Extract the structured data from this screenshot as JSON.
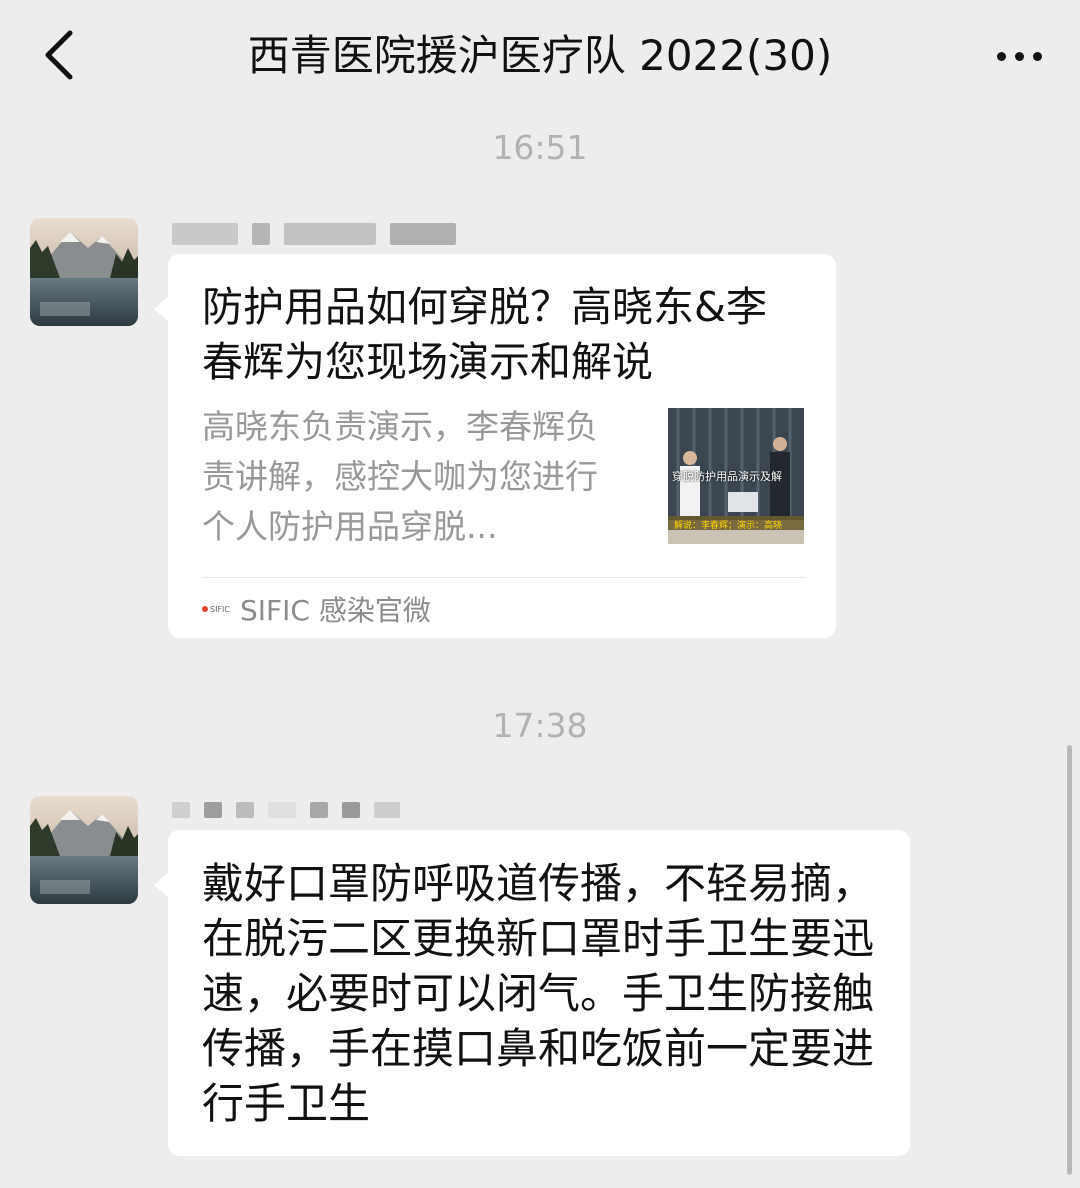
{
  "header": {
    "title": "西青医院援沪医疗队 2022(30)",
    "back_icon": "chevron-left-icon",
    "more_icon": "more-horizontal-icon"
  },
  "messages": [
    {
      "time": "16:51",
      "type": "link-card",
      "card": {
        "title": "防护用品如何穿脱？高晓东&李春辉为您现场演示和解说",
        "description": "高晓东负责演示，李春辉负责讲解，感控大咖为您进行个人防护用品穿脱...",
        "thumb_text": "穿脱防护用品演示及解",
        "thumb_caption": "解说：李春辉；演示：高晓",
        "source_logo_text": "SIFIC",
        "source": "SIFIC 感染官微"
      }
    },
    {
      "time": "17:38",
      "type": "text",
      "text": "戴好口罩防呼吸道传播，不轻易摘，在脱污二区更换新口罩时手卫生要迅速，必要时可以闭气。手卫生防接触传播，手在摸口鼻和吃饭前一定要进行手卫生"
    }
  ],
  "colors": {
    "background": "#ededed",
    "bubble": "#ffffff",
    "timestamp": "#b2b2b2",
    "secondary_text": "#999999"
  }
}
